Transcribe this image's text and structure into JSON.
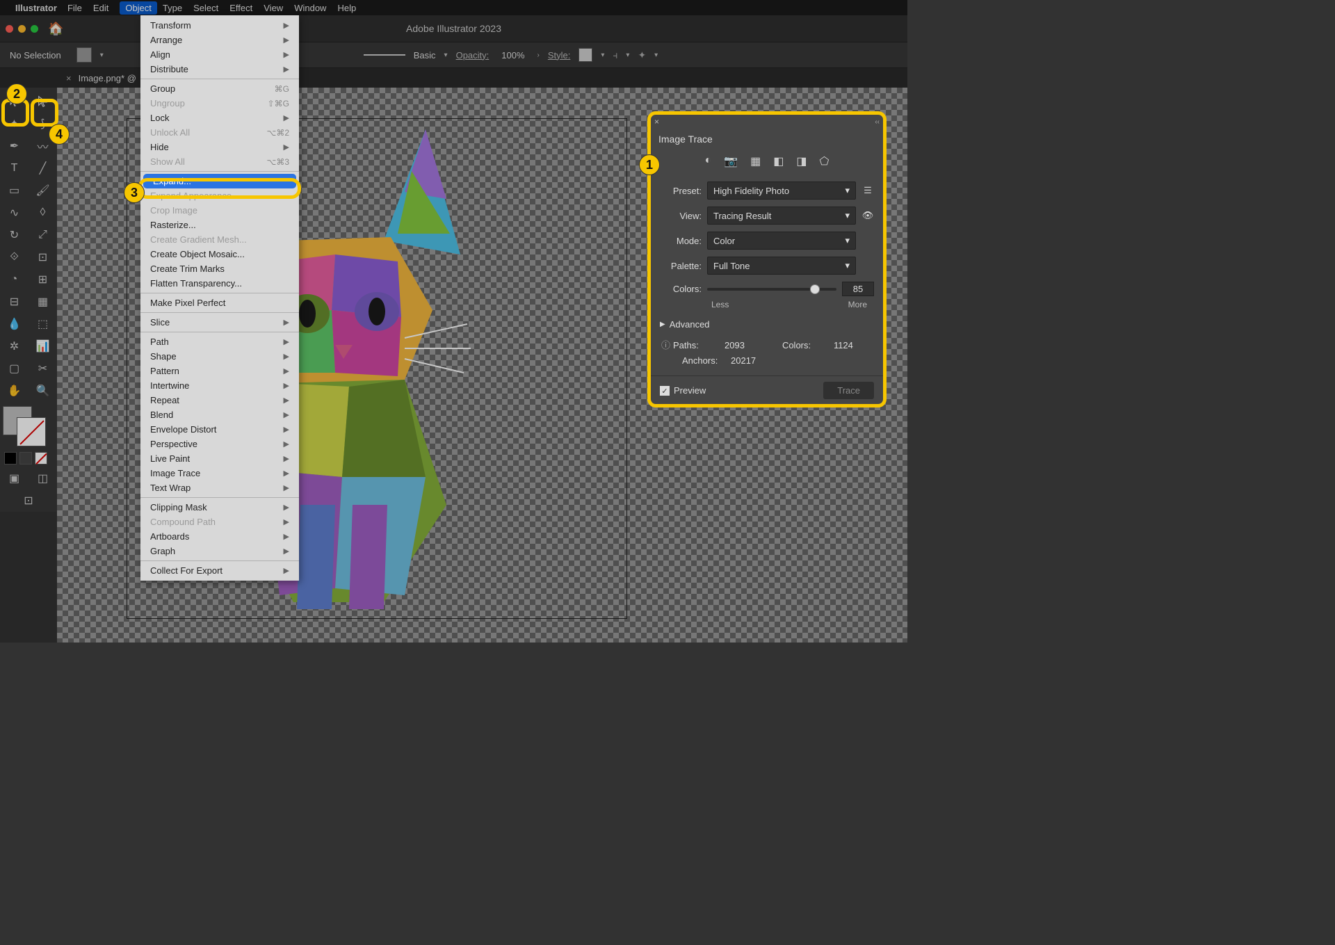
{
  "menubar": {
    "app": "Illustrator",
    "items": [
      "File",
      "Edit",
      "Object",
      "Type",
      "Select",
      "Effect",
      "View",
      "Window",
      "Help"
    ],
    "open_index": 2
  },
  "appbar": {
    "title": "Adobe Illustrator 2023"
  },
  "controlbar": {
    "selection": "No Selection",
    "style_label": "Basic",
    "opacity_label": "Opacity:",
    "opacity_value": "100%",
    "style_text": "Style:"
  },
  "tab": {
    "name": "Image.png* @"
  },
  "dropdown": {
    "groups": [
      [
        {
          "l": "Transform",
          "sub": true
        },
        {
          "l": "Arrange",
          "sub": true
        },
        {
          "l": "Align",
          "sub": true
        },
        {
          "l": "Distribute",
          "sub": true
        }
      ],
      [
        {
          "l": "Group",
          "sc": "⌘G"
        },
        {
          "l": "Ungroup",
          "sc": "⇧⌘G",
          "d": true
        },
        {
          "l": "Lock",
          "sub": true
        },
        {
          "l": "Unlock All",
          "sc": "⌥⌘2",
          "d": true
        },
        {
          "l": "Hide",
          "sub": true
        },
        {
          "l": "Show All",
          "sc": "⌥⌘3",
          "d": true
        }
      ],
      [
        {
          "l": "Expand...",
          "hot": true
        },
        {
          "l": "Expand Appearance",
          "d": true
        },
        {
          "l": "Crop Image",
          "d": true
        },
        {
          "l": "Rasterize..."
        },
        {
          "l": "Create Gradient Mesh...",
          "d": true
        },
        {
          "l": "Create Object Mosaic..."
        },
        {
          "l": "Create Trim Marks"
        },
        {
          "l": "Flatten Transparency..."
        }
      ],
      [
        {
          "l": "Make Pixel Perfect"
        }
      ],
      [
        {
          "l": "Slice",
          "sub": true
        }
      ],
      [
        {
          "l": "Path",
          "sub": true
        },
        {
          "l": "Shape",
          "sub": true
        },
        {
          "l": "Pattern",
          "sub": true
        },
        {
          "l": "Intertwine",
          "sub": true
        },
        {
          "l": "Repeat",
          "sub": true
        },
        {
          "l": "Blend",
          "sub": true
        },
        {
          "l": "Envelope Distort",
          "sub": true
        },
        {
          "l": "Perspective",
          "sub": true
        },
        {
          "l": "Live Paint",
          "sub": true
        },
        {
          "l": "Image Trace",
          "sub": true
        },
        {
          "l": "Text Wrap",
          "sub": true
        }
      ],
      [
        {
          "l": "Clipping Mask",
          "sub": true
        },
        {
          "l": "Compound Path",
          "sub": true,
          "d": true
        },
        {
          "l": "Artboards",
          "sub": true
        },
        {
          "l": "Graph",
          "sub": true
        }
      ],
      [
        {
          "l": "Collect For Export",
          "sub": true
        }
      ]
    ]
  },
  "panel": {
    "title": "Image Trace",
    "preset_label": "Preset:",
    "preset_value": "High Fidelity Photo",
    "view_label": "View:",
    "view_value": "Tracing Result",
    "mode_label": "Mode:",
    "mode_value": "Color",
    "palette_label": "Palette:",
    "palette_value": "Full Tone",
    "colors_label": "Colors:",
    "colors_value": "85",
    "less": "Less",
    "more": "More",
    "advanced": "Advanced",
    "paths_label": "Paths:",
    "paths_value": "2093",
    "colors_stat_label": "Colors:",
    "colors_stat_value": "1124",
    "anchors_label": "Anchors:",
    "anchors_value": "20217",
    "preview_label": "Preview",
    "trace_label": "Trace"
  },
  "badges": {
    "b1": "1",
    "b2": "2",
    "b3": "3",
    "b4": "4"
  }
}
